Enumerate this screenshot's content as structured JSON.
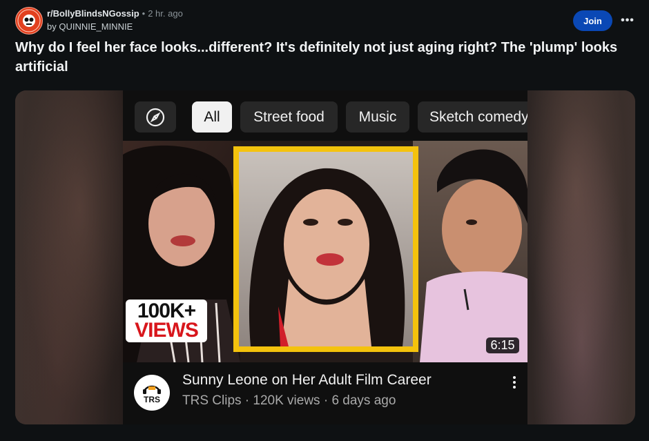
{
  "post": {
    "subreddit": "r/BollyBlindsNGossip",
    "separator": "•",
    "time_ago": "2 hr. ago",
    "author_line": "by QUINNIE_MINNIE",
    "join_label": "Join",
    "more_label": "•••",
    "title": "Why do I feel her face looks...different? It's definitely not just aging right? The 'plump' looks artificial"
  },
  "video": {
    "chips": [
      "All",
      "Street food",
      "Music",
      "Sketch comedy"
    ],
    "explore_icon": "compass-icon",
    "thumbnail_badge_number": "100K+",
    "thumbnail_badge_word": "VIEWS",
    "duration": "6:15",
    "channel_avatar_text": "TRS",
    "title": "Sunny Leone on Her Adult Film Career",
    "meta": "TRS Clips · 120K views · 6 days ago"
  },
  "colors": {
    "join_button": "#0a48b5",
    "thumbnail_frame": "#f4c20d",
    "views_word": "#d8161c",
    "active_chip": "#f1f1f1"
  }
}
